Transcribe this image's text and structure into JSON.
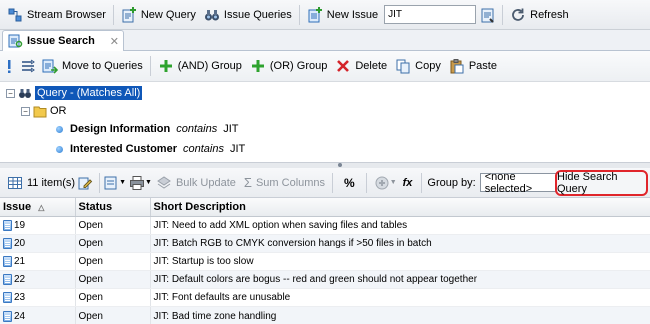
{
  "main_toolbar": {
    "stream_browser": "Stream Browser",
    "new_query": "New Query",
    "issue_queries": "Issue Queries",
    "new_issue": "New Issue",
    "search_value": "JIT",
    "refresh": "Refresh"
  },
  "tabs": [
    {
      "label": "Issue Search",
      "close": "✕"
    }
  ],
  "query_toolbar": {
    "move_to_queries": "Move to Queries",
    "and_group": "(AND) Group",
    "or_group": "(OR) Group",
    "delete": "Delete",
    "copy": "Copy",
    "paste": "Paste"
  },
  "tree": {
    "root": {
      "expander": "−",
      "label": "Query - (Matches All)"
    },
    "or_node": {
      "expander": "−",
      "label": "OR"
    },
    "criteria": [
      {
        "field": "Design Information",
        "operator": "contains",
        "value": "JIT"
      },
      {
        "field": "Interested Customer",
        "operator": "contains",
        "value": "JIT"
      }
    ]
  },
  "results_toolbar": {
    "count": "11 item(s)",
    "bulk_update": "Bulk Update",
    "sum_columns": "Sum Columns",
    "percent": "%",
    "fx": "fx",
    "group_by_label": "Group by:",
    "group_by_value": "<none selected>",
    "hide_search_query": "Hide Search Query"
  },
  "table": {
    "columns": [
      "Issue",
      "Status",
      "Short Description"
    ],
    "sort_indicator": "△",
    "rows": [
      {
        "issue": "19",
        "status": "Open",
        "description": "JIT: Need to add XML option when saving files and tables"
      },
      {
        "issue": "20",
        "status": "Open",
        "description": "JIT: Batch RGB to CMYK conversion hangs if >50 files in batch"
      },
      {
        "issue": "21",
        "status": "Open",
        "description": "JIT: Startup is too slow"
      },
      {
        "issue": "22",
        "status": "Open",
        "description": "JIT: Default colors are bogus -- red and green should not appear together"
      },
      {
        "issue": "23",
        "status": "Open",
        "description": "JIT: Font defaults are unusable"
      },
      {
        "issue": "24",
        "status": "Open",
        "description": "JIT: Bad time zone handling"
      }
    ]
  },
  "colors": {
    "selection": "#0f57b8",
    "highlight_border": "#e0252b",
    "toolbar_bg": "#edf0f3"
  }
}
